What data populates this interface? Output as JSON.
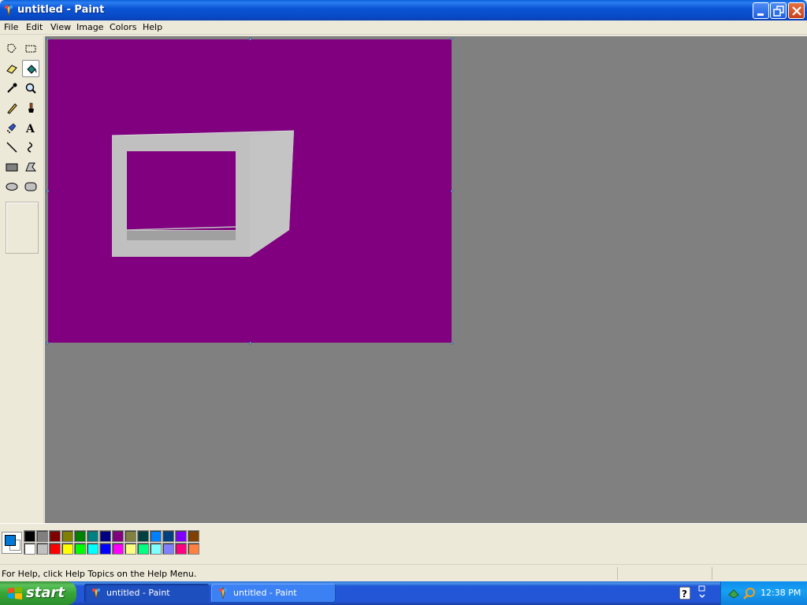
{
  "window": {
    "title": "untitled - Paint"
  },
  "menu": {
    "items": [
      "File",
      "Edit",
      "View",
      "Image",
      "Colors",
      "Help"
    ]
  },
  "tools": [
    {
      "name": "free-form-select",
      "icon": "free-form-select-icon"
    },
    {
      "name": "rect-select",
      "icon": "rect-select-icon"
    },
    {
      "name": "eraser",
      "icon": "eraser-icon"
    },
    {
      "name": "fill",
      "icon": "fill-bucket-icon",
      "selected": true
    },
    {
      "name": "pick-color",
      "icon": "eyedropper-icon"
    },
    {
      "name": "magnifier",
      "icon": "magnifier-icon"
    },
    {
      "name": "pencil",
      "icon": "pencil-icon"
    },
    {
      "name": "brush",
      "icon": "brush-icon"
    },
    {
      "name": "airbrush",
      "icon": "airbrush-icon"
    },
    {
      "name": "text",
      "icon": "text-icon"
    },
    {
      "name": "line",
      "icon": "line-icon"
    },
    {
      "name": "curve",
      "icon": "curve-icon"
    },
    {
      "name": "rectangle",
      "icon": "rectangle-icon"
    },
    {
      "name": "polygon",
      "icon": "polygon-icon"
    },
    {
      "name": "ellipse",
      "icon": "ellipse-icon"
    },
    {
      "name": "rounded-rectangle",
      "icon": "rounded-rectangle-icon"
    }
  ],
  "canvas": {
    "background_color": "#800080",
    "shape_face_color": "#c0c0c0",
    "shape_shadow_color": "#a0a0a0"
  },
  "palette": {
    "foreground": "#0078d7",
    "background": "#ffffff",
    "row1": [
      "#000000",
      "#808080",
      "#800000",
      "#808000",
      "#008000",
      "#008080",
      "#000080",
      "#800080",
      "#808040",
      "#004040",
      "#0080ff",
      "#004080",
      "#8000ff",
      "#804000"
    ],
    "row2": [
      "#ffffff",
      "#c0c0c0",
      "#ff0000",
      "#ffff00",
      "#00ff00",
      "#00ffff",
      "#0000ff",
      "#ff00ff",
      "#ffff80",
      "#00ff80",
      "#80ffff",
      "#8080ff",
      "#ff0080",
      "#ff8040"
    ]
  },
  "status": {
    "help_text": "For Help, click Help Topics on the Help Menu."
  },
  "taskbar": {
    "start_label": "start",
    "tasks": [
      {
        "label": "untitled - Paint",
        "active": true
      },
      {
        "label": "untitled - Paint",
        "active": false
      }
    ],
    "clock": "12:38 PM"
  }
}
